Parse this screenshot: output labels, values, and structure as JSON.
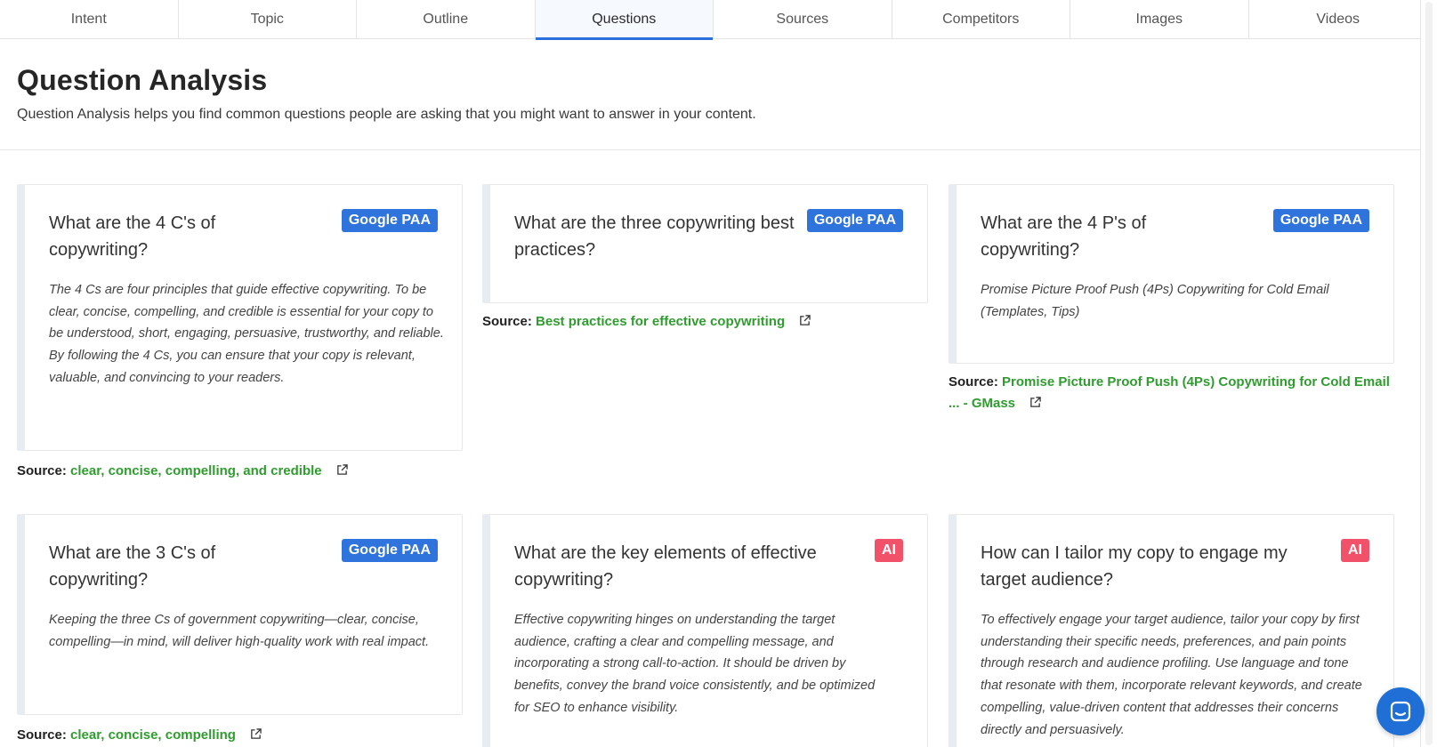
{
  "tabs": [
    "Intent",
    "Topic",
    "Outline",
    "Questions",
    "Sources",
    "Competitors",
    "Images",
    "Videos"
  ],
  "active_tab": "Questions",
  "header": {
    "title": "Question Analysis",
    "subtitle": "Question Analysis helps you find common questions people are asking that you might want to answer in your content."
  },
  "source_label": "Source:",
  "cards": [
    {
      "question": "What are the 4 C's of copywriting?",
      "badge": "Google PAA",
      "answer": "The 4 Cs are four principles that guide effective copywriting. To be clear, concise, compelling, and credible is essential for your copy to be understood, short, engaging, persuasive, trustworthy, and reliable. By following the 4 Cs, you can ensure that your copy is relevant, valuable, and convincing to your readers.",
      "source": "clear, concise, compelling, and credible"
    },
    {
      "question": "What are the three copywriting best practices?",
      "badge": "Google PAA",
      "answer": "",
      "source": "Best practices for effective copywriting"
    },
    {
      "question": "What are the 4 P's of copywriting?",
      "badge": "Google PAA",
      "answer": "Promise Picture Proof Push (4Ps) Copywriting for Cold Email (Templates, Tips)",
      "source": "Promise Picture Proof Push (4Ps) Copywriting for Cold Email ... - GMass"
    },
    {
      "question": "What are the 3 C's of copywriting?",
      "badge": "Google PAA",
      "answer": "Keeping the three Cs of government copywriting—clear, concise, compelling—in mind, will deliver high-quality work with real impact.",
      "source": "clear, concise, compelling"
    },
    {
      "question": "What are the key elements of effective copywriting?",
      "badge": "AI",
      "answer": "Effective copywriting hinges on understanding the target audience, crafting a clear and compelling message, and incorporating a strong call-to-action. It should be driven by benefits, convey the brand voice consistently, and be optimized for SEO to enhance visibility.",
      "source": ""
    },
    {
      "question": "How can I tailor my copy to engage my target audience?",
      "badge": "AI",
      "answer": "To effectively engage your target audience, tailor your copy by first understanding their specific needs, preferences, and pain points through research and audience profiling. Use language and tone that resonate with them, incorporate relevant keywords, and create compelling, value-driven content that addresses their concerns directly and persuasively.",
      "source": ""
    }
  ],
  "colors": {
    "accent": "#2a6fdb",
    "badge_paa": "#2f73dd",
    "badge_ai": "#f1526a",
    "source_link": "#2e9d2e"
  },
  "icons": [
    "external-link-icon",
    "chat-icon"
  ]
}
